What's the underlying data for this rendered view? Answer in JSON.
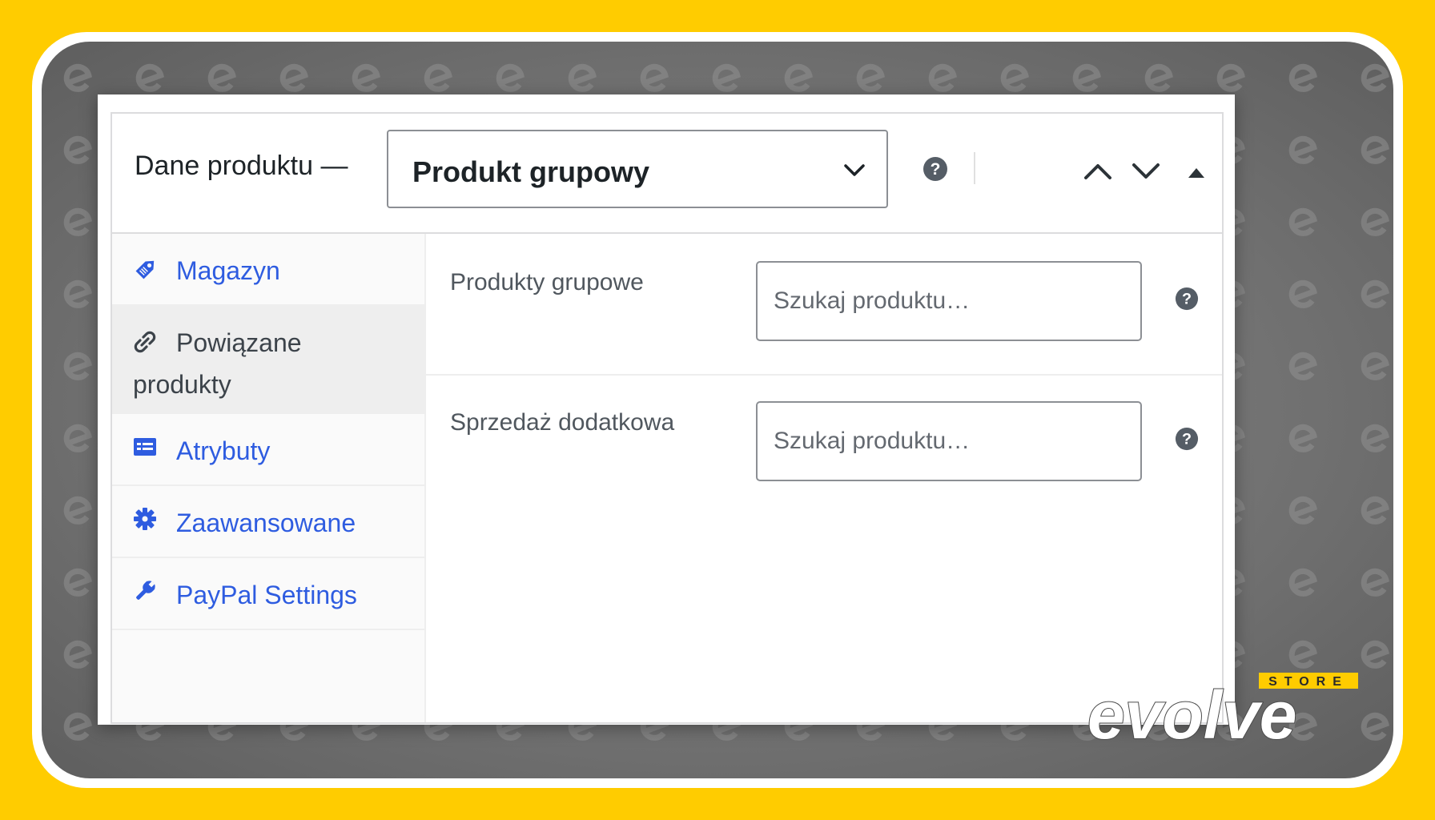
{
  "header": {
    "title": "Dane produktu —",
    "product_type": {
      "selected": "Produkt grupowy"
    }
  },
  "sidebar": {
    "tabs": [
      {
        "label": "Magazyn",
        "icon": "tag-icon",
        "active": false
      },
      {
        "label": "Powiązane produkty",
        "icon": "link-icon",
        "active": true
      },
      {
        "label": "Atrybuty",
        "icon": "attributes-list-icon",
        "active": false
      },
      {
        "label": "Zaawansowane",
        "icon": "gear-icon",
        "active": false
      },
      {
        "label": "PayPal Settings",
        "icon": "wrench-icon",
        "active": false
      }
    ]
  },
  "fields": [
    {
      "label": "Produkty grupowe",
      "placeholder": "Szukaj produktu…"
    },
    {
      "label": "Sprzedaż dodatkowa",
      "placeholder": "Szukaj produktu…"
    }
  ],
  "branding": {
    "logo_word": "evolve",
    "logo_badge": "STORE"
  },
  "colors": {
    "outer_background": "#FFCC00",
    "link_blue": "#2e5ce0",
    "help_icon": "#555d66",
    "logo_yellow": "#FFCC00"
  }
}
